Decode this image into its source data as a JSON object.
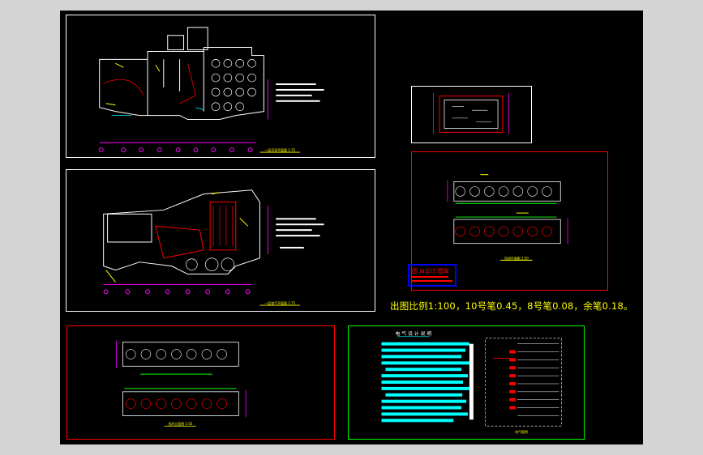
{
  "viewer": {
    "background": "#d4d4d4",
    "canvas_color": "#000000"
  },
  "sheets": [
    {
      "id": "floor-plan-1",
      "frame_color": "#ffffff",
      "caption": "一层吊顶平面图 1:75"
    },
    {
      "id": "floor-plan-2",
      "frame_color": "#ffffff",
      "caption": "一层电气平面图 1:75"
    },
    {
      "id": "detail-small",
      "frame_color": "#ffffff"
    },
    {
      "id": "private-rooms-elevation",
      "frame_color": "#ff0000",
      "caption": "包间立面图 1:50"
    },
    {
      "id": "private-rooms-lower",
      "frame_color": "#ff0000",
      "caption": "包间平面图 1:50"
    },
    {
      "id": "design-notes",
      "frame_color": "#00ff00",
      "title": "电 气 设 计 说 明",
      "legend_caption": "电气图例"
    }
  ],
  "title_block": {
    "label": "图 Jo设计 图库",
    "border_color": "#0000ff"
  },
  "scale_note": "出图比例1:100，10号笔0.45，8号笔0.08，余笔0.18。",
  "colors": {
    "white": "#ffffff",
    "red": "#ff0000",
    "yellow": "#ffff00",
    "magenta": "#ff00ff",
    "cyan": "#00ffff",
    "green": "#00ff00",
    "blue": "#0000ff"
  }
}
